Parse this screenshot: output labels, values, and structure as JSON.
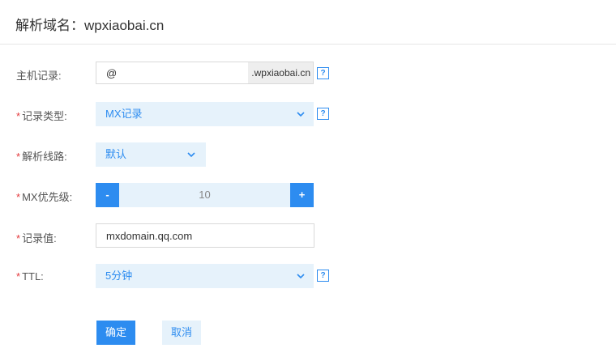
{
  "header": {
    "title": "解析域名：wpxiaobai.cn"
  },
  "form": {
    "required_mark": "*",
    "host": {
      "label": "主机记录:",
      "value": "@",
      "suffix": ".wpxiaobai.cn",
      "help": "?"
    },
    "record_type": {
      "label": "记录类型:",
      "value": "MX记录",
      "help": "?"
    },
    "line": {
      "label": "解析线路:",
      "value": "默认"
    },
    "mx_priority": {
      "label": "MX优先级:",
      "value": "10",
      "minus": "-",
      "plus": "+"
    },
    "record_value": {
      "label": "记录值:",
      "value": "mxdomain.qq.com"
    },
    "ttl": {
      "label": "TTL:",
      "value": "5分钟",
      "help": "?"
    }
  },
  "actions": {
    "confirm": "确定",
    "cancel": "取消"
  },
  "colors": {
    "accent": "#2d8cf0",
    "accent_light": "#e6f2fb",
    "required": "#e4393c"
  }
}
